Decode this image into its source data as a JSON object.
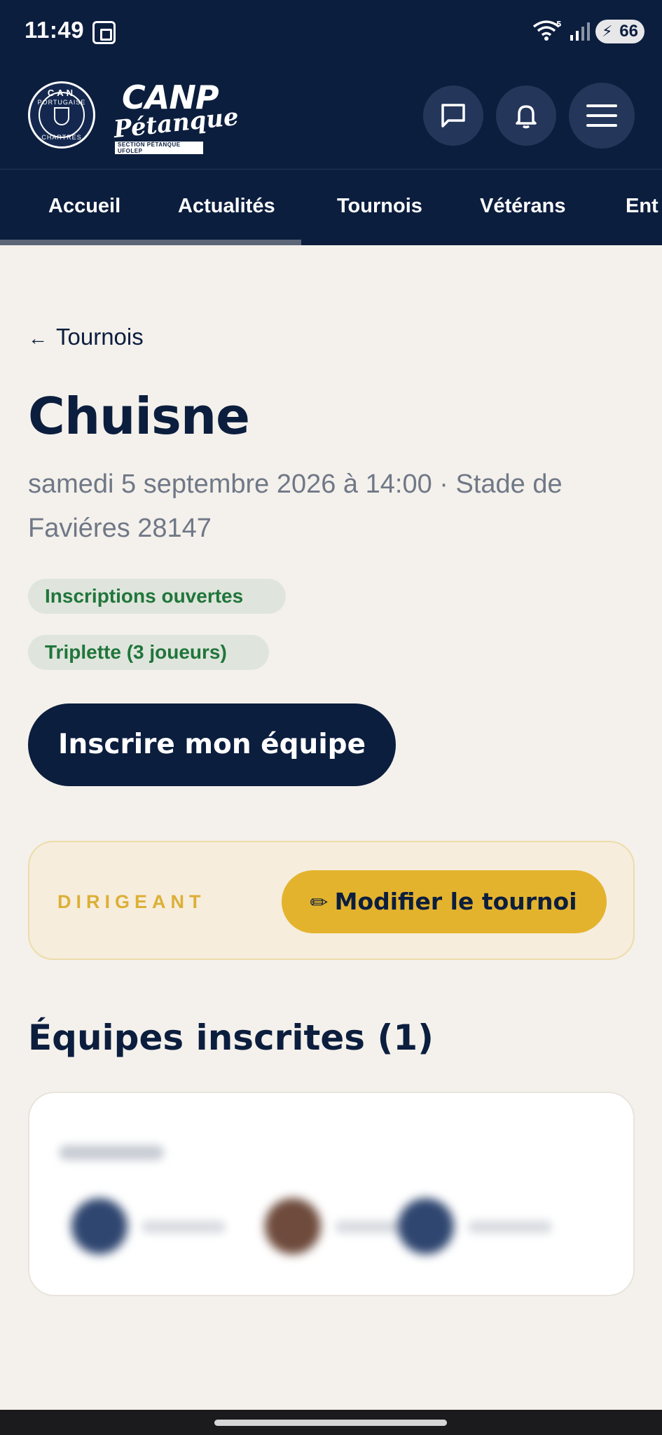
{
  "status_bar": {
    "time": "11:49",
    "battery": "66",
    "wifi_badge": "5"
  },
  "header": {
    "club_logo": {
      "top_text": "CAN",
      "middle_text": "PORTUGAISE",
      "bottom_text": "CHARTRES"
    },
    "brand_logo": {
      "line1": "CANP",
      "line2": "Pétanque",
      "line3": "SECTION PÉTANQUE UFOLEP"
    },
    "buttons": [
      "messages",
      "notifications",
      "menu"
    ]
  },
  "nav": {
    "tabs": [
      {
        "label": "Accueil"
      },
      {
        "label": "Actualités"
      },
      {
        "label": "Tournois"
      },
      {
        "label": "Vétérans"
      },
      {
        "label": "Ent"
      }
    ]
  },
  "page": {
    "back_label": "Tournois",
    "title": "Chuisne",
    "meta": "samedi 5 septembre 2026 à 14:00 · Stade de Faviéres 28147",
    "badges": {
      "status": "Inscriptions ouvertes",
      "format": "Triplette (3 joueurs)"
    },
    "register_button": "Inscrire mon équipe",
    "admin": {
      "label": "DIRIGEANT",
      "edit_button": "Modifier le tournoi"
    },
    "teams_title": "Équipes inscrites (1)"
  },
  "colors": {
    "navy": "#0c1e3e",
    "background": "#f4f1ec",
    "badge_green": "#20753b",
    "gold": "#e4b32d"
  }
}
